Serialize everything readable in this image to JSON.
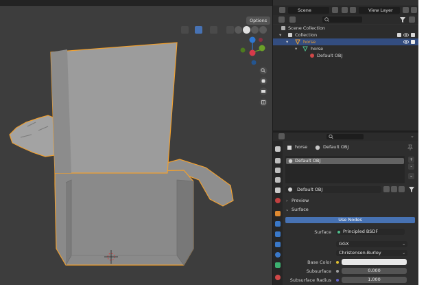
{
  "viewport": {
    "options_label": "Options"
  },
  "header": {
    "scene": "Scene",
    "view_layer": "View Layer"
  },
  "outliner": {
    "rows": [
      {
        "label": "Scene Collection"
      },
      {
        "label": "Collection"
      },
      {
        "label": "horse"
      },
      {
        "label": "horse"
      },
      {
        "label": "Default OBJ"
      }
    ]
  },
  "properties": {
    "object_name": "horse",
    "material_name": "Default OBJ",
    "slot_item": "Default OBJ",
    "material_field": "Default OBJ",
    "panel_preview": "Preview",
    "panel_surface": "Surface",
    "use_nodes_label": "Use Nodes",
    "surface_label": "Surface",
    "surface_value": "Principled BSDF",
    "distribution": "GGX",
    "subsurface_method": "Christensen-Burley",
    "base_color_label": "Base Color",
    "subsurface_label": "Subsurface",
    "subsurface_value": "0.000",
    "subsurface_radius_label": "Subsurface Radius",
    "subsurface_radius_value": "1.000"
  },
  "colors": {
    "selection_outline": "#f0a030",
    "active_row": "#334d80",
    "use_nodes": "#4772b3",
    "axis_x": "#d73a4a",
    "axis_y": "#6ba028",
    "axis_z": "#2f77d1"
  },
  "icons": [
    "gear-icon",
    "zoom-icon",
    "hand-icon",
    "camera-icon",
    "grid-icon",
    "eye-icon",
    "funnel-icon",
    "search-icon",
    "pin-icon",
    "material-sphere-icon",
    "mesh-triangle-icon"
  ]
}
